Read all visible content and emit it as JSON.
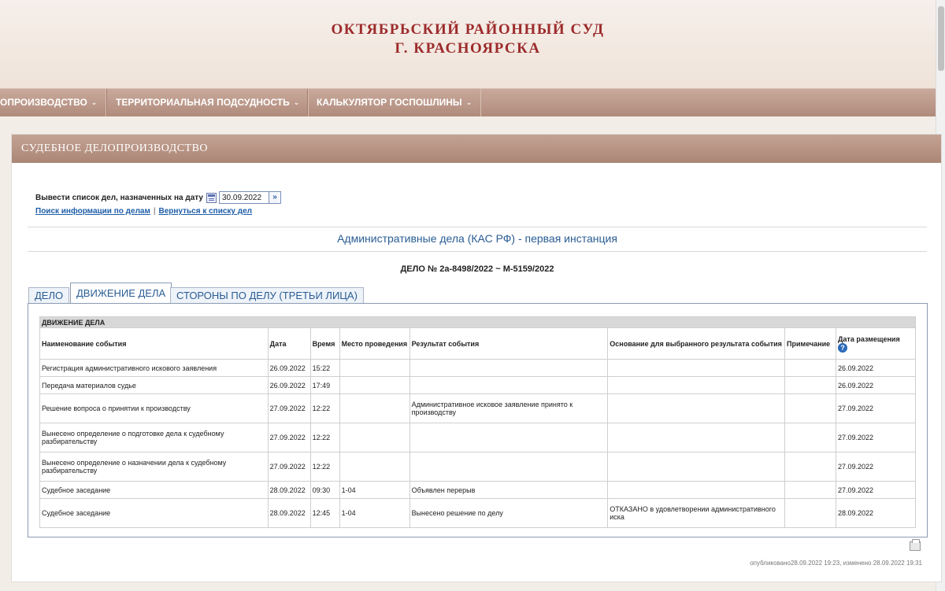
{
  "header": {
    "title_line1": "ОКТЯБРЬСКИЙ РАЙОННЫЙ СУД",
    "title_line2": "Г. КРАСНОЯРСКА"
  },
  "nav": {
    "items": [
      {
        "label": "ОПРОИЗВОДСТВО"
      },
      {
        "label": "ТЕРРИТОРИАЛЬНАЯ ПОДСУДНОСТЬ"
      },
      {
        "label": "КАЛЬКУЛЯТОР ГОСПОШЛИНЫ"
      }
    ]
  },
  "panel": {
    "title": "СУДЕБНОЕ ДЕЛОПРОИЗВОДСТВО",
    "date_label": "Вывести список дел, назначенных на дату",
    "date_value": "30.09.2022",
    "link_search": "Поиск информации по делам",
    "link_separator": "|",
    "link_back": "Вернуться к списку дел",
    "category": "Административные дела (КАС РФ) - первая инстанция",
    "case_number": "ДЕЛО № 2а-8498/2022 ~ М-5159/2022"
  },
  "tabs": [
    {
      "label": "ДЕЛО"
    },
    {
      "label": "ДВИЖЕНИЕ ДЕЛА"
    },
    {
      "label": "СТОРОНЫ ПО ДЕЛУ (ТРЕТЬИ ЛИЦА)"
    }
  ],
  "table": {
    "title": "ДВИЖЕНИЕ ДЕЛА",
    "headers": [
      "Наименование события",
      "Дата",
      "Время",
      "Место проведения",
      "Результат события",
      "Основание для выбранного результата события",
      "Примечание",
      "Дата размещения"
    ],
    "help_glyph": "?",
    "rows": [
      [
        "Регистрация административного искового заявления",
        "26.09.2022",
        "15:22",
        "",
        "",
        "",
        "",
        "26.09.2022"
      ],
      [
        "Передача материалов судье",
        "26.09.2022",
        "17:49",
        "",
        "",
        "",
        "",
        "26.09.2022"
      ],
      [
        "Решение вопроса о принятии к производству",
        "27.09.2022",
        "12:22",
        "",
        "Административное исковое заявление принято к производству",
        "",
        "",
        "27.09.2022"
      ],
      [
        "Вынесено определение о подготовке дела к судебному разбирательству",
        "27.09.2022",
        "12:22",
        "",
        "",
        "",
        "",
        "27.09.2022"
      ],
      [
        "Вынесено определение о назначении дела к судебному разбирательству",
        "27.09.2022",
        "12:22",
        "",
        "",
        "",
        "",
        "27.09.2022"
      ],
      [
        "Судебное заседание",
        "28.09.2022",
        "09:30",
        "1-04",
        "Объявлен перерыв",
        "",
        "",
        "27.09.2022"
      ],
      [
        "Судебное заседание",
        "28.09.2022",
        "12:45",
        "1-04",
        "Вынесено решение по делу",
        "ОТКАЗАНО в удовлетворении административного иска",
        "",
        "28.09.2022"
      ]
    ]
  },
  "footer": {
    "meta": "опубликовано28.09.2022 19:23, изменено 28.09.2022 19:31"
  },
  "colors": {
    "title_red": "#9c2b2b",
    "nav_bg": "#b08b7c",
    "link_blue": "#1f5ea8"
  }
}
